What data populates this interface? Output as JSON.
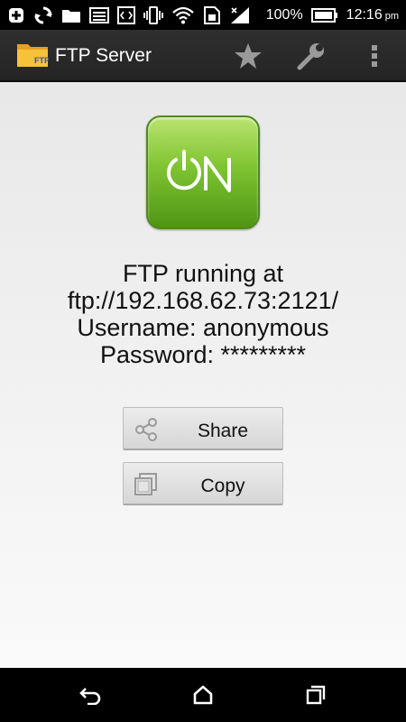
{
  "status_bar": {
    "battery_percent": "100%",
    "time": "12:16",
    "ampm": "pm",
    "icons": [
      "add-icon",
      "sync-icon",
      "folder-icon",
      "image-icon",
      "code-icon",
      "vibrate-icon",
      "wifi-icon",
      "sim-icon",
      "signal-icon",
      "battery-icon"
    ]
  },
  "action_bar": {
    "title": "FTP Server",
    "icon_label": "FTP",
    "actions": [
      "star-icon",
      "wrench-icon",
      "overflow-menu-icon"
    ]
  },
  "main": {
    "power_button_label": "ON",
    "status_lines": [
      "FTP running at",
      "ftp://192.168.62.73:2121/",
      "Username: anonymous",
      "Password: *********"
    ],
    "share_label": "Share",
    "copy_label": "Copy"
  },
  "nav_bar": {
    "buttons": [
      "back-icon",
      "home-icon",
      "recents-icon"
    ]
  },
  "colors": {
    "on_button_top": "#b9e36f",
    "on_button_bottom": "#4f9514",
    "action_bar": "#2a2a2a"
  }
}
